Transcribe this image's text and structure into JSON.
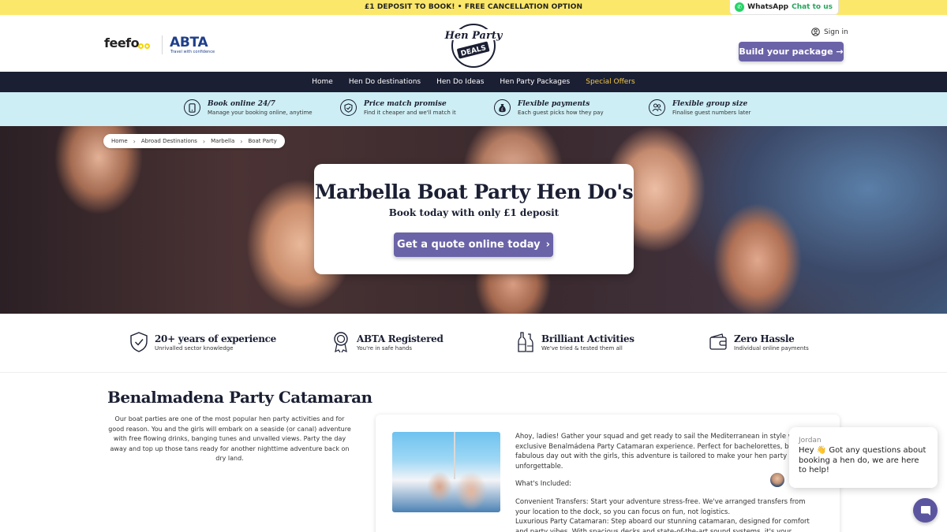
{
  "promo": {
    "text": "£1 DEPOSIT TO BOOK! • FREE CANCELLATION OPTION"
  },
  "whatsapp": {
    "label": "WhatsApp",
    "cta": "Chat to us"
  },
  "header": {
    "feefo": "feefo",
    "abta": "ABTA",
    "abta_tagline": "Travel with confidence",
    "logo": {
      "line1": "Hen Party",
      "line2": "DEALS"
    },
    "signin": "Sign in",
    "build_button": "Build your package →"
  },
  "nav": {
    "items": [
      "Home",
      "Hen Do destinations",
      "Hen Do Ideas",
      "Hen Party Packages",
      "Special Offers"
    ]
  },
  "features": [
    {
      "title": "Book online 24/7",
      "sub": "Manage your booking online, anytime",
      "icon": "phone-icon"
    },
    {
      "title": "Price match promise",
      "sub": "Find it cheaper and we'll match it",
      "icon": "shield-check-icon"
    },
    {
      "title": "Flexible payments",
      "sub": "Each guest picks how they pay",
      "icon": "money-bag-icon"
    },
    {
      "title": "Flexible group size",
      "sub": "Finalise guest numbers later",
      "icon": "group-icon"
    }
  ],
  "breadcrumb": [
    "Home",
    "Abroad Destinations",
    "Marbella",
    "Boat Party"
  ],
  "hero": {
    "title": "Marbella Boat Party Hen Do's",
    "subtitle": "Book today with only £1 deposit",
    "cta": "Get a quote online today"
  },
  "trust": [
    {
      "title": "20+ years of experience",
      "sub": "Unrivalled sector knowledge",
      "icon": "shield-check-icon"
    },
    {
      "title": "ABTA Registered",
      "sub": "You're in safe hands",
      "icon": "award-badge-icon"
    },
    {
      "title": "Brilliant Activities",
      "sub": "We've tried & tested them all",
      "icon": "bottles-icon"
    },
    {
      "title": "Zero Hassle",
      "sub": "Individual online payments",
      "icon": "wallet-icon"
    }
  ],
  "content": {
    "title": "Benalmadena Party Catamaran",
    "intro": "Our boat parties are one of the most popular hen party activities and for good reason. You and the girls will embark on a seaside (or canal) adventure with free flowing drinks, banging tunes and unvalled views. Party the day away and top up those tans ready for another nighttime adventure back on dry land.",
    "card": {
      "p1": "Ahoy, ladies! Gather your squad and get ready to sail the Mediterranean in style with o exclusive Benalmádena Party Catamaran experience. Perfect for bachelorettes, birthd a fabulous day out with the girls, this adventure is tailored to make your hen party unforgettable.",
      "p2": "What's Included:",
      "p3": "Convenient Transfers: Start your adventure stress-free. We've arranged transfers from your location to the dock, so you can focus on fun, not logistics.",
      "p4": "Luxurious Party Catamaran: Step aboard our stunning catamaran, designed for comfort and party vibes. With spacious decks and state-of-the-art sound systems, it's your floating party"
    }
  },
  "chat": {
    "name": "Jordan",
    "message": "Hey 👋 Got any questions about booking a hen do, we are here to help!"
  },
  "colors": {
    "promo_bg": "#fbe86a",
    "nav_bg": "#1b1f33",
    "accent_purple": "#6a63a8",
    "special_offer": "#f3c843",
    "features_bg": "#cdeef4"
  }
}
